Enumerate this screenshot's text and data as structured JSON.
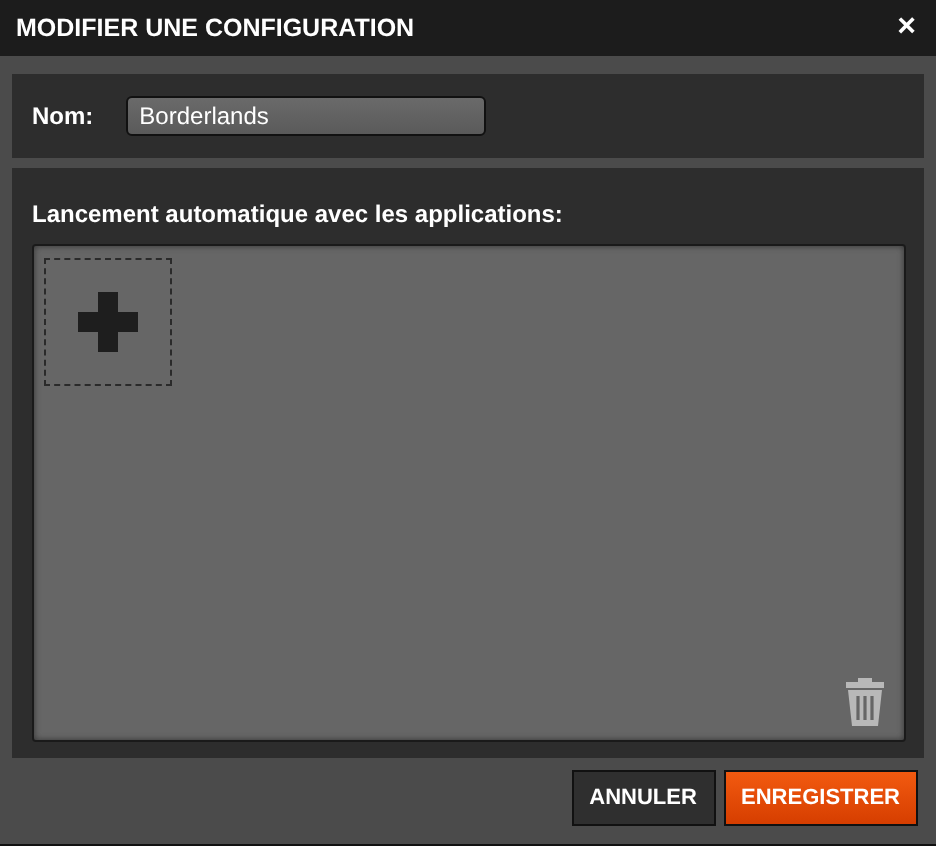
{
  "window": {
    "title": "MODIFIER UNE CONFIGURATION",
    "close": "×"
  },
  "name_field": {
    "label": "Nom:",
    "value": "Borderlands"
  },
  "applications": {
    "label": "Lancement automatique avec les applications:"
  },
  "buttons": [
    {
      "label": "ANNULER",
      "kind": "secondary"
    },
    {
      "label": "ENREGISTRER",
      "kind": "primary"
    }
  ]
}
